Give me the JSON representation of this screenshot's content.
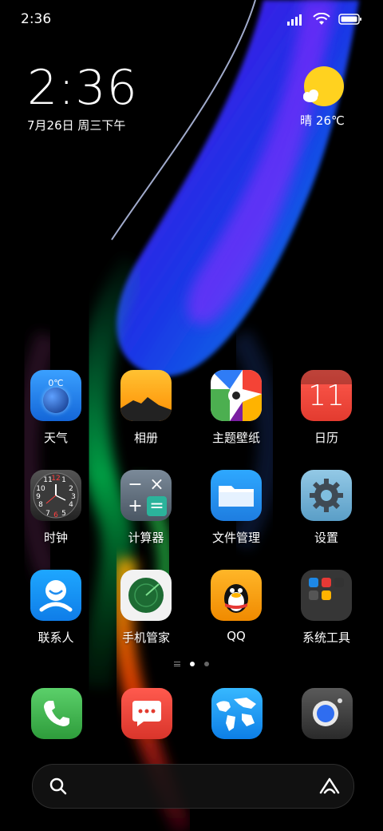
{
  "status_bar": {
    "time": "2:36"
  },
  "clock": {
    "time": "2:36",
    "date": "7月26日 周三下午"
  },
  "weather": {
    "text": "晴 26℃"
  },
  "apps": [
    {
      "label": "天气",
      "badge": "0℃"
    },
    {
      "label": "相册"
    },
    {
      "label": "主题壁纸"
    },
    {
      "label": "日历",
      "day": "11"
    },
    {
      "label": "时钟"
    },
    {
      "label": "计算器"
    },
    {
      "label": "文件管理"
    },
    {
      "label": "设置"
    },
    {
      "label": "联系人"
    },
    {
      "label": "手机管家"
    },
    {
      "label": "QQ"
    },
    {
      "label": "系统工具"
    }
  ],
  "clock_face_numbers": [
    "11",
    "12",
    "1",
    "10",
    "2",
    "9",
    "3",
    "8",
    "4",
    "7",
    "6",
    "5"
  ],
  "calc_symbols": [
    "−",
    "×",
    "+",
    "="
  ],
  "page_indicator": {
    "pages": 2,
    "current": 1
  },
  "dock": [
    {
      "name": "phone",
      "icon": "phone-icon"
    },
    {
      "name": "messages",
      "icon": "message-icon"
    },
    {
      "name": "browser",
      "icon": "globe-icon"
    },
    {
      "name": "camera",
      "icon": "camera-icon"
    }
  ],
  "search": {
    "left_icon": "search-icon",
    "right_icon": "assistant-icon"
  },
  "colors": {
    "weather_sun": "#FFD21F",
    "calendar_red": "#F04A3E",
    "phone_green": "#4CAF50",
    "messages_red": "#F2433A",
    "qq_orange": "#F4A31B"
  }
}
